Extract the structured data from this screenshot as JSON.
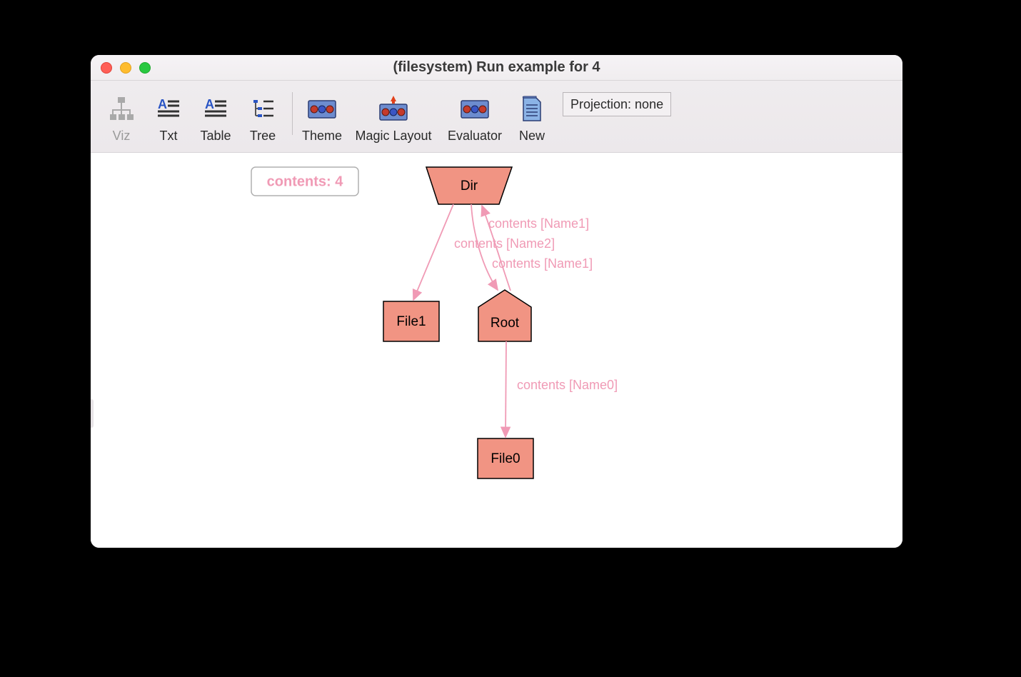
{
  "window": {
    "title": "(filesystem) Run example for 4"
  },
  "toolbar": {
    "viz": "Viz",
    "txt": "Txt",
    "table": "Table",
    "tree": "Tree",
    "theme": "Theme",
    "magic_layout": "Magic Layout",
    "evaluator": "Evaluator",
    "new": "New",
    "projection": "Projection: none"
  },
  "legend": {
    "contents": "contents: 4"
  },
  "nodes": {
    "dir": "Dir",
    "file1": "File1",
    "root": "Root",
    "file0": "File0"
  },
  "edges": {
    "dir_root_1": "contents [Name1]",
    "dir_file1": "contents [Name2]",
    "root_dir": "contents [Name1]",
    "root_file0": "contents [Name0]"
  }
}
